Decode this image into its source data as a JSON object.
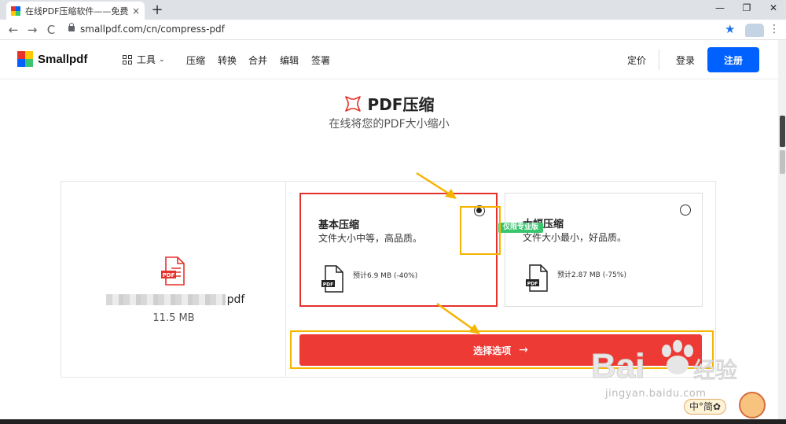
{
  "browser": {
    "tab_title": "在线PDF压缩软件——免费压缩",
    "tab_close": "×",
    "new_tab": "+",
    "url": "smallpdf.com/cn/compress-pdf",
    "nav_back": "←",
    "nav_forward": "→",
    "nav_reload": "C",
    "win_min": "—",
    "win_max": "❐",
    "win_close": "✕",
    "star": "★",
    "menu": "⋮"
  },
  "header": {
    "logo": "Smallpdf",
    "tools": "工具",
    "tools_chevron": "⌄",
    "nav": [
      "压缩",
      "转换",
      "合并",
      "编辑",
      "签署"
    ],
    "pricing": "定价",
    "login": "登录",
    "signup": "注册"
  },
  "page": {
    "title": "PDF压缩",
    "subtitle": "在线将您的PDF大小缩小"
  },
  "file": {
    "name_suffix": "pdf",
    "size": "11.5 MB",
    "pdf_label": "PDF"
  },
  "options": [
    {
      "title": "基本压缩",
      "desc": "文件大小中等，高品质。",
      "estimate": "预计6.9 MB (-40%)",
      "selected": true
    },
    {
      "title": "大幅压缩",
      "desc": "文件大小最小，好品质。",
      "estimate": "预计2.87 MB (-75%)",
      "selected": false
    }
  ],
  "pro_badge": "仅限专业版",
  "cta": {
    "label": "选择选项",
    "arrow": "→"
  },
  "watermark": {
    "brand": "Bai",
    "brand2": "经验",
    "url": "jingyan.baidu.com"
  },
  "ime": "中°简✿",
  "colors": {
    "accent": "#0061fe",
    "brand_red": "#e5322d",
    "cta": "#ee3a34",
    "pro": "#3ac66f",
    "annotation": "#f5b400"
  }
}
